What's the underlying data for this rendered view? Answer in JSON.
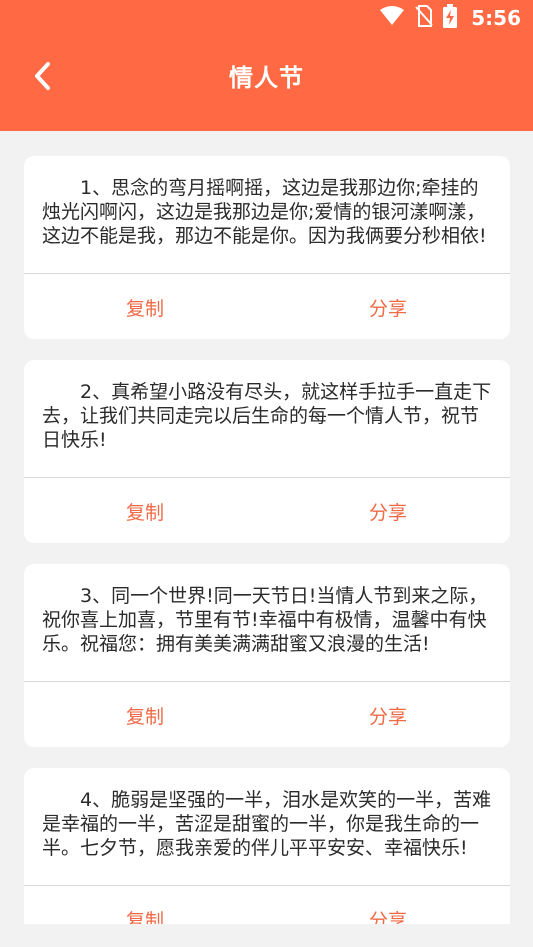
{
  "status_bar": {
    "time": "5:56",
    "icons": [
      "wifi-icon",
      "no-sim-icon",
      "battery-charging-icon"
    ]
  },
  "header": {
    "title": "情人节",
    "back_icon": "back-arrow-icon"
  },
  "colors": {
    "header_bg": "#ff6a45",
    "accent_text": "#f06a45",
    "page_bg": "#f2f2f2",
    "card_bg": "#ffffff"
  },
  "cards": [
    {
      "text": "1、思念的弯月摇啊摇，这边是我那边你;牵挂的烛光闪啊闪，这边是我那边是你;爱情的银河漾啊漾，这边不能是我，那边不能是你。因为我俩要分秒相依!",
      "copy_label": "复制",
      "share_label": "分享"
    },
    {
      "text": "2、真希望小路没有尽头，就这样手拉手一直走下去，让我们共同走完以后生命的每一个情人节，祝节日快乐!",
      "copy_label": "复制",
      "share_label": "分享"
    },
    {
      "text": "3、同一个世界!同一天节日!当情人节到来之际，祝你喜上加喜，节里有节!幸福中有极情，温馨中有快乐。祝福您：拥有美美满满甜蜜又浪漫的生活!",
      "copy_label": "复制",
      "share_label": "分享"
    },
    {
      "text": "4、脆弱是坚强的一半，泪水是欢笑的一半，苦难是幸福的一半，苦涩是甜蜜的一半，你是我生命的一半。七夕节，愿我亲爱的伴儿平平安安、幸福快乐!",
      "copy_label": "复制",
      "share_label": "分享"
    }
  ]
}
